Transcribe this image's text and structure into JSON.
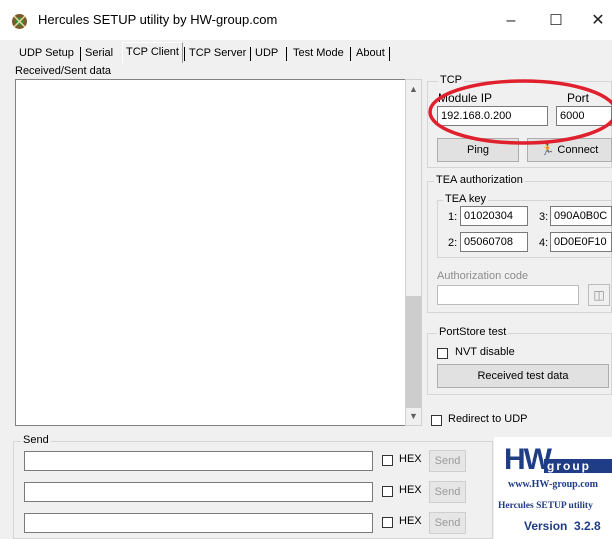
{
  "window": {
    "title": "Hercules SETUP utility by HW-group.com",
    "minimize": "–",
    "maximize": "☐",
    "close": "✕"
  },
  "tabs": [
    "UDP Setup",
    "Serial",
    "TCP Client",
    "TCP Server",
    "UDP",
    "Test Mode",
    "About"
  ],
  "active_tab": "TCP Client",
  "received": {
    "label": "Received/Sent data"
  },
  "tcp": {
    "group_title": "TCP",
    "module_ip_label": "Module IP",
    "module_ip_value": "192.168.0.200",
    "port_label": "Port",
    "port_value": "6000",
    "ping_label": "Ping",
    "connect_label": "Connect"
  },
  "tea": {
    "group_title": "TEA authorization",
    "key_title": "TEA key",
    "keys": [
      {
        "label": "1:",
        "value": "01020304"
      },
      {
        "label": "3:",
        "value": "090A0B0C"
      },
      {
        "label": "2:",
        "value": "05060708"
      },
      {
        "label": "4:",
        "value": "0D0E0F10"
      }
    ],
    "auth_code_label": "Authorization code"
  },
  "portstore": {
    "group_title": "PortStore test",
    "nvt_label": "NVT disable",
    "received_test_label": "Received test data"
  },
  "redirect_label": "Redirect to UDP",
  "send": {
    "group_title": "Send",
    "rows": [
      {
        "hex_label": "HEX",
        "send_label": "Send"
      },
      {
        "hex_label": "HEX",
        "send_label": "Send"
      },
      {
        "hex_label": "HEX",
        "send_label": "Send"
      }
    ]
  },
  "logo": {
    "brand_big": "HW",
    "brand_small": "group",
    "url": "www.HW-group.com",
    "product": "Hercules SETUP utility",
    "version": "Version  3.2.8"
  },
  "colors": {
    "annotation_circle": "#e0202c",
    "logo_blue": "#1f3d86"
  }
}
